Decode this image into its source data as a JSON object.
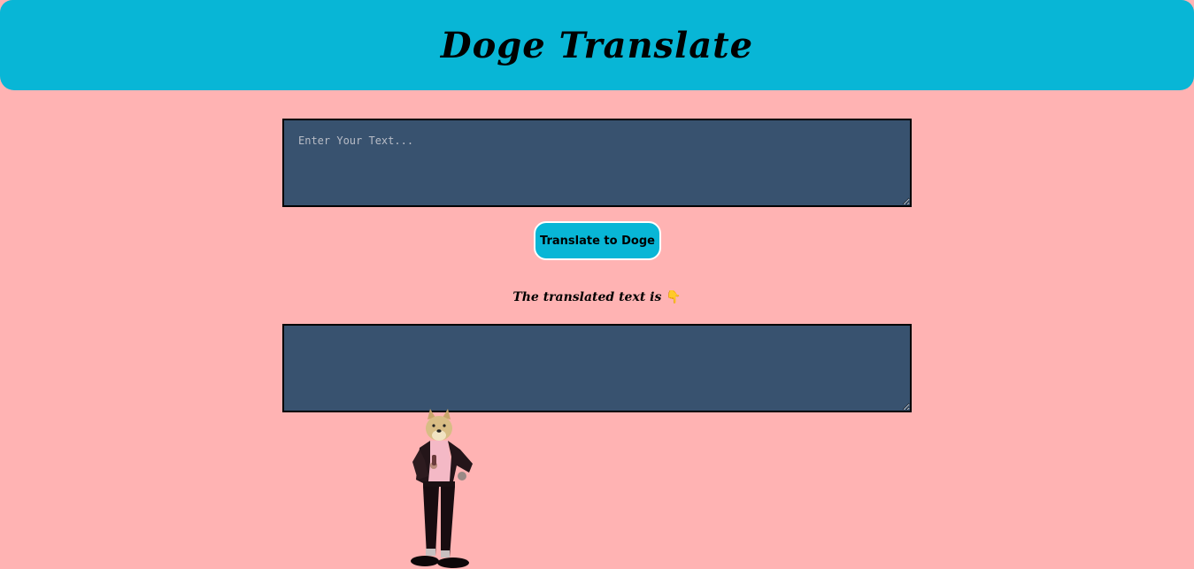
{
  "header": {
    "title": "Doge Translate"
  },
  "input": {
    "placeholder": "Enter Your Text...",
    "value": ""
  },
  "translate_button": {
    "label": "Translate to Doge"
  },
  "result": {
    "label": "The translated text is",
    "pointer_emoji": "👇",
    "value": ""
  },
  "colors": {
    "background": "#ffb3b3",
    "header": "#08b6d6",
    "textbox": "#38526f",
    "button": "#08b6d6"
  },
  "icons": {
    "mascot": "dancing-doge-icon",
    "pointer": "pointing-down-hand-icon"
  }
}
